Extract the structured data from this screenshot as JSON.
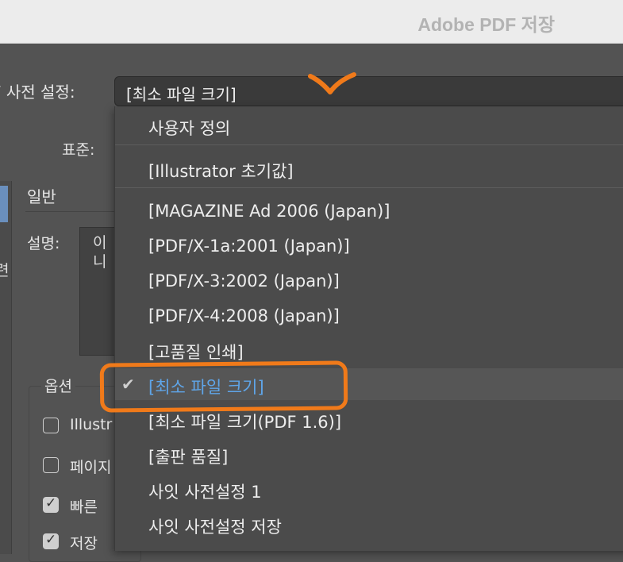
{
  "window": {
    "title": "Adobe PDF 저장"
  },
  "preset": {
    "label": "F 사전 설정:",
    "value": "[최소 파일 크기]"
  },
  "standard": {
    "label": "표준:"
  },
  "left_pane": {
    "text": "련"
  },
  "general": {
    "section_label": "일반"
  },
  "description": {
    "label": "설명:",
    "line1": "이",
    "line2": "니"
  },
  "options": {
    "label": "옵션",
    "items": [
      {
        "label": "Illustr",
        "checked": false
      },
      {
        "label": "페이지",
        "checked": false
      },
      {
        "label": "빠른",
        "checked": true
      },
      {
        "label": "저장",
        "checked": true
      }
    ]
  },
  "dropdown": {
    "items": [
      {
        "label": "사용자 정의",
        "selected": false
      },
      {
        "label": "[Illustrator 초기값]",
        "selected": false
      },
      {
        "label": "[MAGAZINE Ad 2006 (Japan)]",
        "selected": false
      },
      {
        "label": "[PDF/X-1a:2001 (Japan)]",
        "selected": false
      },
      {
        "label": "[PDF/X-3:2002 (Japan)]",
        "selected": false
      },
      {
        "label": "[PDF/X-4:2008 (Japan)]",
        "selected": false
      },
      {
        "label": "[고품질 인쇄]",
        "selected": false
      },
      {
        "label": "[최소 파일 크기]",
        "selected": true
      },
      {
        "label": "[최소 파일 크기(PDF 1.6)]",
        "selected": false
      },
      {
        "label": "[출판 품질]",
        "selected": false
      },
      {
        "label": "사잇 사전설정 1",
        "selected": false
      },
      {
        "label": "사잇 사전설정 저장",
        "selected": false
      }
    ]
  },
  "colors": {
    "annotation": "#f07a1a",
    "selected_text": "#5fa5e8",
    "background": "#535353"
  }
}
